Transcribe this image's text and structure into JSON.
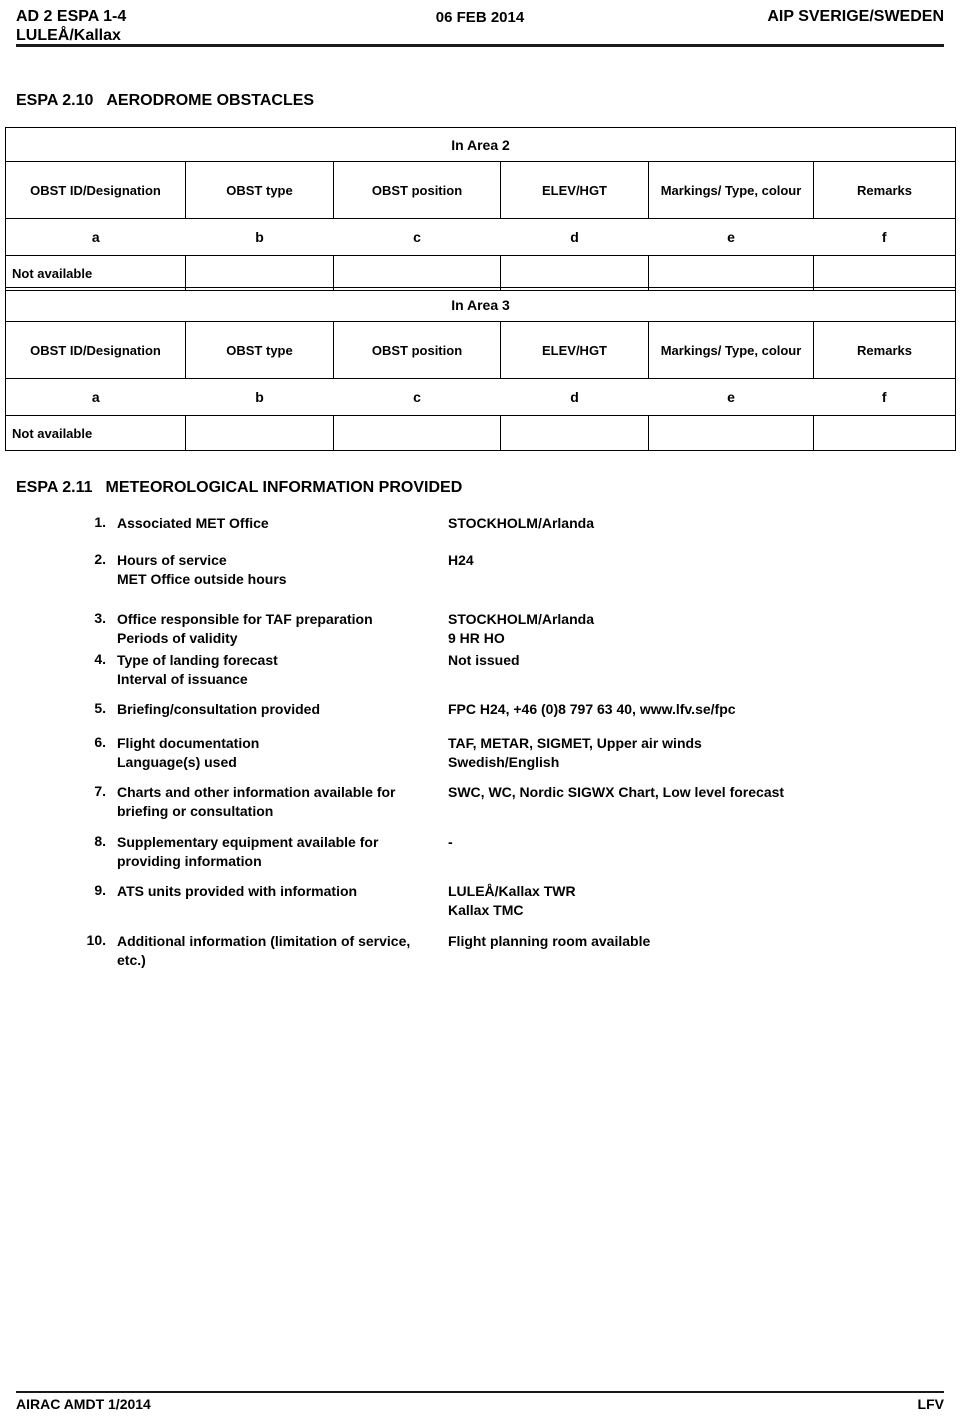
{
  "header": {
    "left_line1": "AD 2 ESPA 1-4",
    "left_line2": "LULEÅ/Kallax",
    "center": "06 FEB 2014",
    "right": "AIP SVERIGE/SWEDEN"
  },
  "sections": {
    "obstacles": {
      "number": "ESPA 2.10",
      "title": "AERODROME OBSTACLES"
    },
    "meteorological": {
      "number": "ESPA 2.11",
      "title": "METEOROLOGICAL INFORMATION PROVIDED"
    }
  },
  "obstacle_tables": [
    {
      "area_title": "In Area 2",
      "column_headers": [
        "OBST ID/Designation",
        "OBST type",
        "OBST position",
        "ELEV/HGT",
        "Markings/ Type, colour",
        "Remarks"
      ],
      "column_letters": [
        "a",
        "b",
        "c",
        "d",
        "e",
        "f"
      ],
      "data_row": [
        "Not available",
        "",
        "",
        "",
        "",
        ""
      ]
    },
    {
      "area_title": "In Area 3",
      "column_headers": [
        "OBST ID/Designation",
        "OBST type",
        "OBST position",
        "ELEV/HGT",
        "Markings/ Type, colour",
        "Remarks"
      ],
      "column_letters": [
        "a",
        "b",
        "c",
        "d",
        "e",
        "f"
      ],
      "data_row": [
        "Not available",
        "",
        "",
        "",
        "",
        ""
      ]
    }
  ],
  "met_items": [
    {
      "number": "1.",
      "label_line1": "Associated MET Office",
      "label_line2": "",
      "value_line1": "STOCKHOLM/Arlanda",
      "value_line2": ""
    },
    {
      "number": "2.",
      "label_line1": "Hours of service",
      "label_line2": "MET Office outside hours",
      "value_line1": "H24",
      "value_line2": ""
    },
    {
      "number": "3.",
      "label_line1": "Office responsible for TAF preparation",
      "label_line2": "Periods of validity",
      "value_line1": "STOCKHOLM/Arlanda",
      "value_line2": "9 HR HO"
    },
    {
      "number": "4.",
      "label_line1": "Type of landing forecast",
      "label_line2": "Interval of issuance",
      "value_line1": "Not issued",
      "value_line2": ""
    },
    {
      "number": "5.",
      "label_line1": "Briefing/consultation provided",
      "label_line2": "",
      "value_line1": "FPC H24, +46 (0)8 797 63 40, www.lfv.se/fpc",
      "value_line2": ""
    },
    {
      "number": "6.",
      "label_line1": "Flight documentation",
      "label_line2": "Language(s) used",
      "value_line1": "TAF, METAR, SIGMET, Upper air winds",
      "value_line2": "Swedish/English"
    },
    {
      "number": "7.",
      "label_line1": "Charts and other information available for",
      "label_line2": "briefing or consultation",
      "value_line1": "SWC, WC, Nordic SIGWX Chart, Low level forecast",
      "value_line2": ""
    },
    {
      "number": "8.",
      "label_line1": "Supplementary equipment available for",
      "label_line2": "providing information",
      "value_line1": "-",
      "value_line2": ""
    },
    {
      "number": "9.",
      "label_line1": "ATS units provided with information",
      "label_line2": "",
      "value_line1": "LULEÅ/Kallax TWR",
      "value_line2": "Kallax TMC"
    },
    {
      "number": "10.",
      "label_line1": "Additional information (limitation of service,",
      "label_line2": "etc.)",
      "value_line1": "Flight planning room available",
      "value_line2": ""
    }
  ],
  "footer": {
    "left": "AIRAC AMDT 1/2014",
    "right": "LFV"
  }
}
